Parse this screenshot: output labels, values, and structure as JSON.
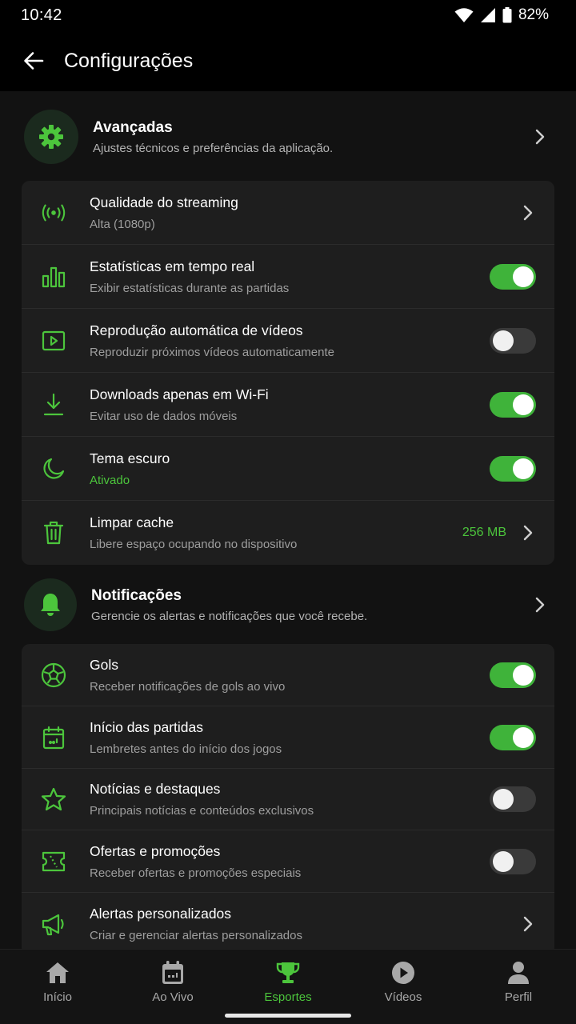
{
  "status_bar": {
    "time": "10:42",
    "battery": "82%"
  },
  "app_bar": {
    "title": "Configurações"
  },
  "sections": {
    "advanced": {
      "title": "Avançadas",
      "subtitle": "Ajustes técnicos e preferências da aplicação.",
      "icon": "gear-icon"
    },
    "notifications": {
      "title": "Notificações",
      "subtitle": "Gerencie os alertas e notificações que você recebe.",
      "icon": "bell-icon"
    }
  },
  "advanced_items": [
    {
      "title": "Qualidade do streaming",
      "subtitle": "Alta (1080p)",
      "control": "chevron",
      "icon": "broadcast-icon"
    },
    {
      "title": "Estatísticas em tempo real",
      "subtitle": "Exibir estatísticas durante as partidas",
      "control": "toggle",
      "on": true,
      "icon": "bar-chart-icon"
    },
    {
      "title": "Reprodução automática de vídeos",
      "subtitle": "Reproduzir próximos vídeos automaticamente",
      "control": "toggle",
      "on": false,
      "icon": "video-play-icon"
    },
    {
      "title": "Downloads apenas em Wi-Fi",
      "subtitle": "Evitar uso de dados móveis",
      "control": "toggle",
      "on": true,
      "icon": "download-icon"
    },
    {
      "title": "Tema escuro",
      "subtitle": "Ativado",
      "control": "toggle",
      "on": true,
      "icon": "moon-icon"
    },
    {
      "title": "Limpar cache",
      "subtitle": "Libere espaço ocupando no dispositivo",
      "control": "chevron",
      "value": "256 MB",
      "icon": "trash-icon"
    }
  ],
  "notification_items": [
    {
      "title": "Gols",
      "subtitle": "Receber notificações de gols ao vivo",
      "control": "toggle",
      "on": true,
      "icon": "soccer-ball-icon"
    },
    {
      "title": "Início das partidas",
      "subtitle": "Lembretes antes do início dos jogos",
      "control": "toggle",
      "on": true,
      "icon": "calendar-icon"
    },
    {
      "title": "Notícias e destaques",
      "subtitle": "Principais notícias e conteúdos exclusivos",
      "control": "toggle",
      "on": false,
      "icon": "star-icon"
    },
    {
      "title": "Ofertas e promoções",
      "subtitle": "Receber ofertas e promoções especiais",
      "control": "toggle",
      "on": false,
      "icon": "ticket-icon"
    },
    {
      "title": "Alertas personalizados",
      "subtitle": "Criar e gerenciar alertas personalizados",
      "control": "chevron",
      "icon": "megaphone-icon"
    }
  ],
  "bottom_nav": [
    {
      "label": "Início",
      "icon": "home-icon",
      "active": false
    },
    {
      "label": "Ao Vivo",
      "icon": "live-calendar-icon",
      "active": false
    },
    {
      "label": "Esportes",
      "icon": "trophy-icon",
      "active": true
    },
    {
      "label": "Vídeos",
      "icon": "play-circle-icon",
      "active": false
    },
    {
      "label": "Perfil",
      "icon": "person-icon",
      "active": false
    }
  ],
  "colors": {
    "accent": "#4cc53c",
    "toggle_on": "#3fb33a",
    "card": "#1e1e1e",
    "background": "#121212"
  }
}
